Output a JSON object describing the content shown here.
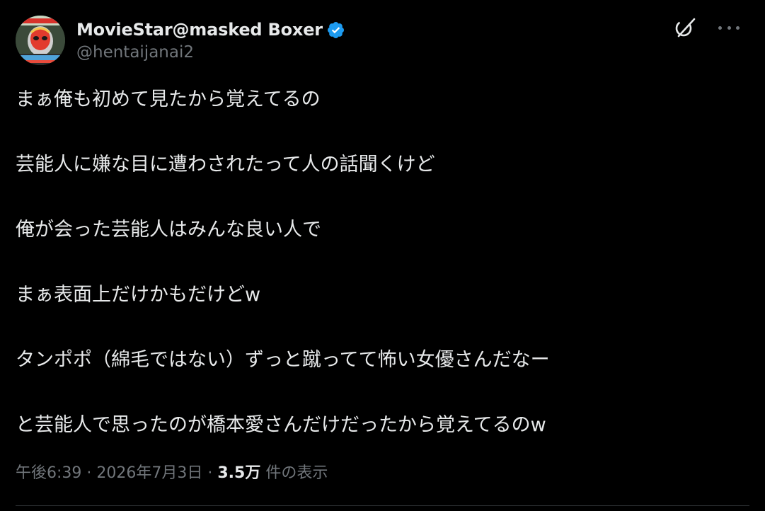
{
  "author": {
    "display_name": "MovieStar@masked Boxer",
    "handle": "@hentaijanai2",
    "verified": true,
    "verified_color": "#1d9bf0"
  },
  "actions": {
    "grok_icon": "grok-icon",
    "more_icon": "more-dots-icon"
  },
  "tweet": {
    "lines": [
      "まぁ俺も初めて見たから覚えてるの",
      "芸能人に嫌な目に遭わされたって人の話聞くけど",
      "俺が会った芸能人はみんな良い人で",
      "まぁ表面上だけかもだけどw",
      "タンポポ（綿毛ではない）ずっと蹴ってて怖い女優さんだなー",
      "と芸能人で思ったのが橋本愛さんだけだったから覚えてるのw"
    ]
  },
  "meta": {
    "time": "午後6:39",
    "separator": " · ",
    "date": "2026年7月3日",
    "views_count": "3.5万",
    "views_label": " 件の表示"
  },
  "colors": {
    "background": "#000000",
    "text_primary": "#e7e9ea",
    "text_secondary": "#71767b",
    "divider": "#2f3336"
  }
}
